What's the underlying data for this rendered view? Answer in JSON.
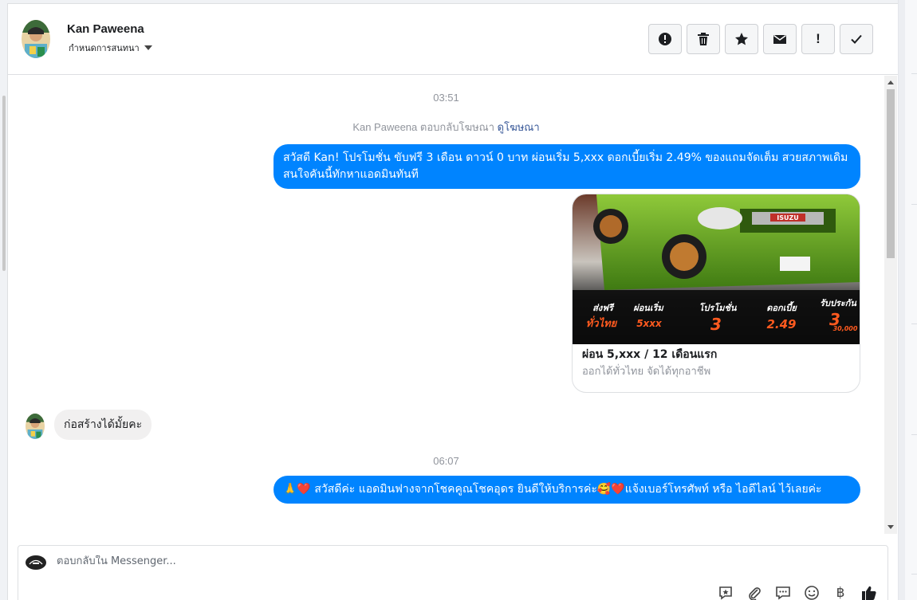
{
  "header": {
    "contact_name": "Kan Paweena",
    "conversation_settings": "กำหนดการสนทนา",
    "actions": [
      {
        "name": "spam",
        "icon": "alert-circle-icon"
      },
      {
        "name": "delete",
        "icon": "trash-icon"
      },
      {
        "name": "star",
        "icon": "star-icon"
      },
      {
        "name": "mark-unread",
        "icon": "envelope-icon"
      },
      {
        "name": "follow-up",
        "icon": "exclamation-icon",
        "label": "!"
      },
      {
        "name": "mark-done",
        "icon": "check-icon"
      }
    ]
  },
  "thread": {
    "timestamp_1": "03:51",
    "ad_reply_prefix": "Kan Paweena ตอบกลับโฆษณา",
    "ad_reply_link": "ดูโฆษณา",
    "message_1": "สวัสดี Kan! โปรโมชั่น ขับฟรี 3 เดือน ดาวน์ 0 บาท ผ่อนเริ่ม 5,xxx  ดอกเบี้ยเริ่ม 2.49% ของแถมจัดเต็ม สวยสภาพเดิม สนใจคันนี้ทักหาแอดมินทันที",
    "ad_card": {
      "title": "ผ่อน 5,xxx / 12 เดือนแรก",
      "subtitle": "ออกได้ทั่วไทย จัดได้ทุกอาชีพ",
      "banner": {
        "free_ship_top": "ส่งฟรี",
        "free_ship_bottom": "ทั่วไทย",
        "installment_top": "ผ่อนเริ่ม",
        "installment_value": "5xxx",
        "promo_top": "โปรโมชั่น",
        "promo_value": "3",
        "interest_top": "ดอกเบี้ย",
        "interest_value": "2.49",
        "warranty_top": "รับประกัน",
        "warranty_value": "3",
        "warranty_amount": "30,000",
        "plate_brand": "ISUZU"
      }
    },
    "incoming_1": "ก่อสร้างได้มั้ยคะ",
    "timestamp_2": "06:07",
    "message_2": "🙏❤️ สวัสดีค่ะ แอดมินฟางจากโชคคูณโชคอุดร ยินดีให้บริการค่ะ🥰❤️แจ้งเบอร์โทรศัพท์ หรือ ไอดีไลน์  ไว้เลยค่ะ"
  },
  "composer": {
    "placeholder": "ตอบกลับใน Messenger...",
    "tools": [
      {
        "name": "saved-reply",
        "icon": "saved-reply-icon"
      },
      {
        "name": "attach",
        "icon": "paperclip-icon"
      },
      {
        "name": "quick-reply",
        "icon": "chat-bubbles-icon"
      },
      {
        "name": "emoji",
        "icon": "smiley-icon"
      },
      {
        "name": "payment",
        "icon": "baht-icon",
        "label": "฿"
      },
      {
        "name": "like",
        "icon": "thumbs-up-icon"
      }
    ]
  },
  "colors": {
    "messenger_blue": "#0084ff",
    "incoming_gray": "#f1f0f0",
    "link_blue": "#385898"
  }
}
